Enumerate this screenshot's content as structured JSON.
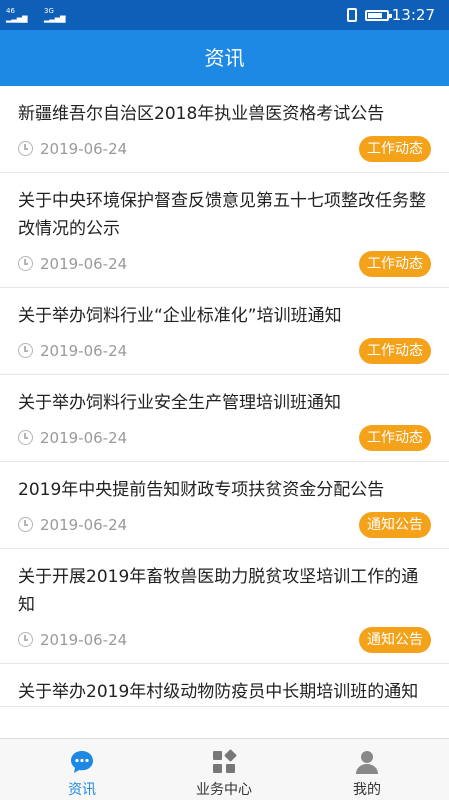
{
  "status_bar": {
    "network_1": "46",
    "network_2": "3G",
    "time": "13:27"
  },
  "header": {
    "title": "资讯"
  },
  "news": [
    {
      "title": "新疆维吾尔自治区2018年执业兽医资格考试公告",
      "date": "2019-06-24",
      "tag": "工作动态"
    },
    {
      "title": "关于中央环境保护督查反馈意见第五十七项整改任务整改情况的公示",
      "date": "2019-06-24",
      "tag": "工作动态"
    },
    {
      "title": "关于举办饲料行业“企业标准化”培训班通知",
      "date": "2019-06-24",
      "tag": "工作动态"
    },
    {
      "title": "关于举办饲料行业安全生产管理培训班通知",
      "date": "2019-06-24",
      "tag": "工作动态"
    },
    {
      "title": "2019年中央提前告知财政专项扶贫资金分配公告",
      "date": "2019-06-24",
      "tag": "通知公告"
    },
    {
      "title": "关于开展2019年畜牧兽医助力脱贫攻坚培训工作的通知",
      "date": "2019-06-24",
      "tag": "通知公告"
    },
    {
      "title": "关于举办2019年村级动物防疫员中长期培训班的通知",
      "date": "",
      "tag": ""
    }
  ],
  "tabs": [
    {
      "label": "资讯",
      "icon": "chat-bubble-icon",
      "active": true
    },
    {
      "label": "业务中心",
      "icon": "grid-apps-icon",
      "active": false
    },
    {
      "label": "我的",
      "icon": "person-icon",
      "active": false
    }
  ],
  "colors": {
    "header": "#1e88e5",
    "statusbar": "#0d5fb8",
    "tag": "#f5a21b",
    "active_tab": "#1e88e5"
  }
}
